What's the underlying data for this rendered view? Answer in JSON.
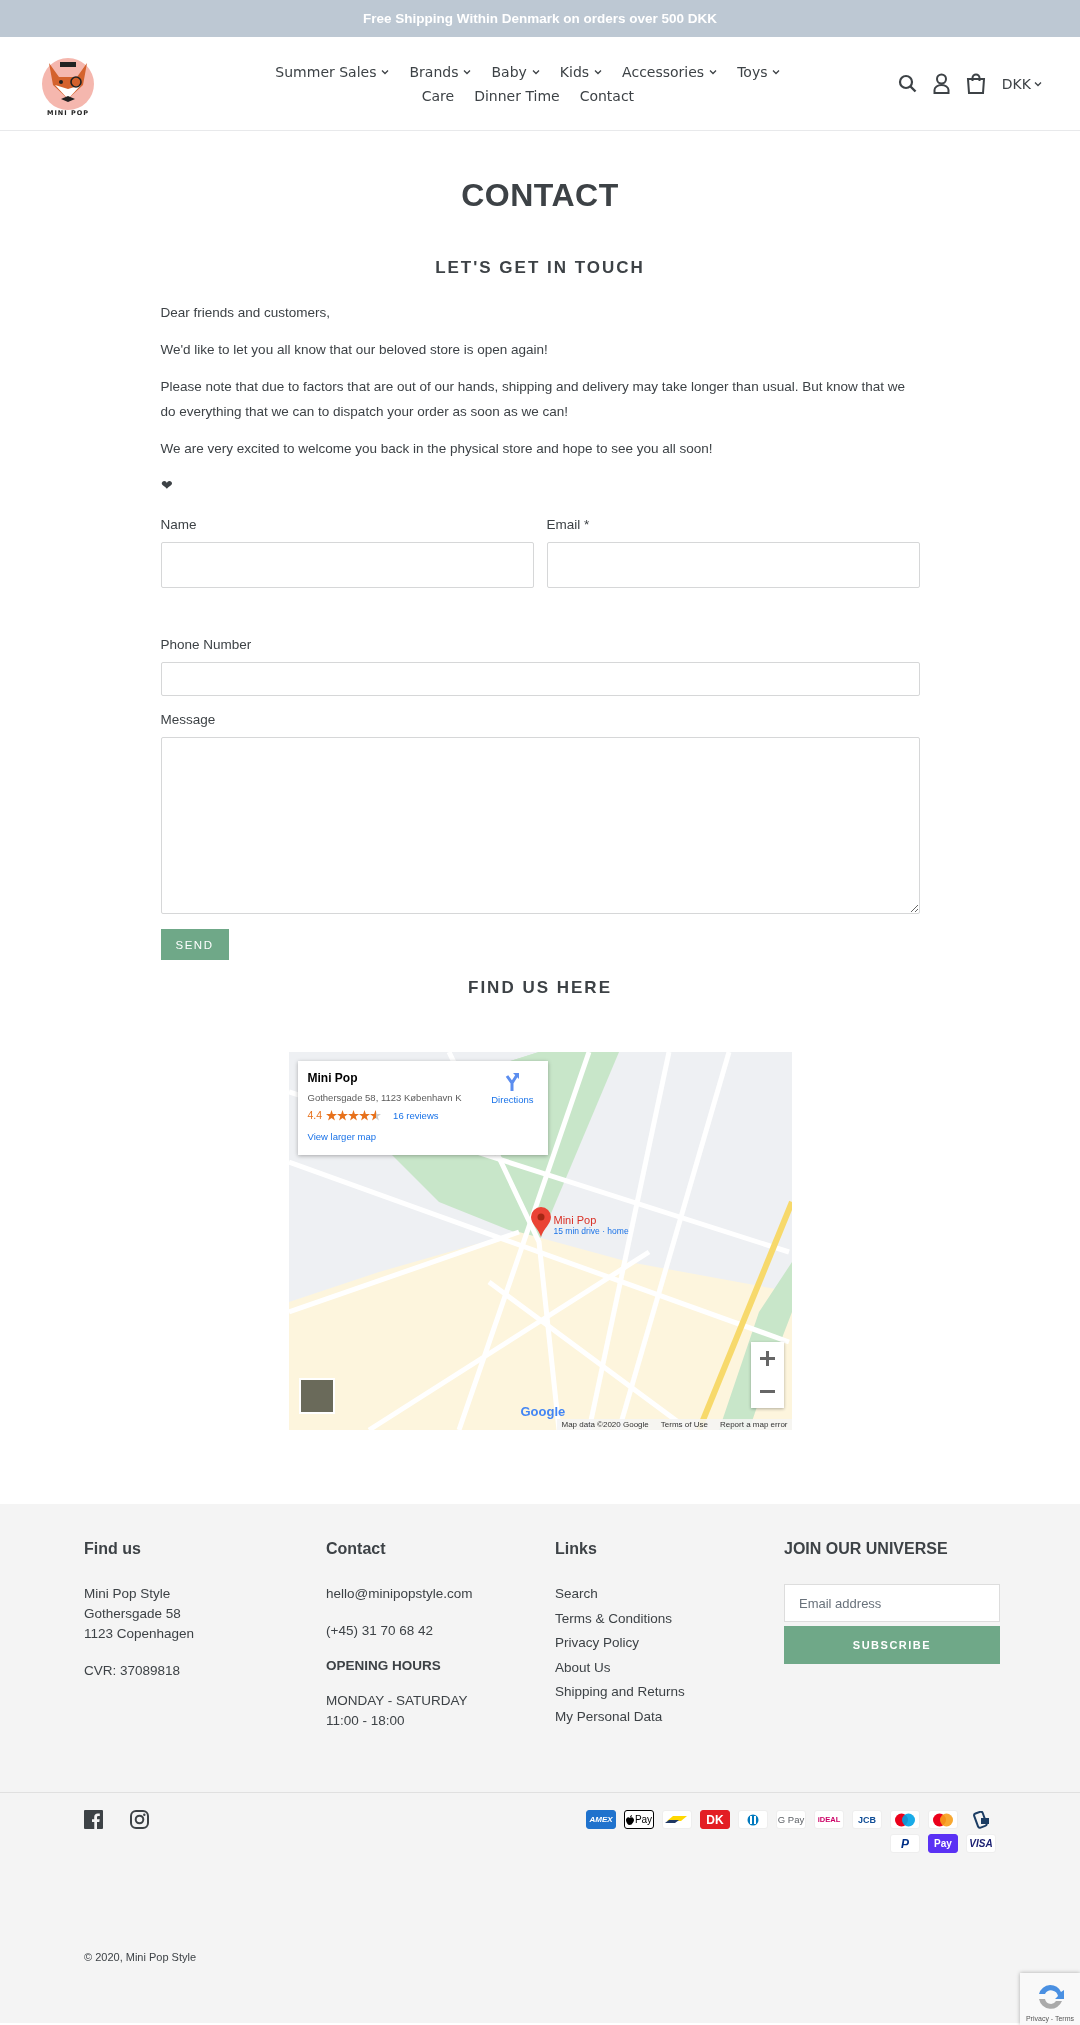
{
  "announcement": "Free Shipping Within Denmark on orders over 500 DKK",
  "header": {
    "logo_text": "MINI POP",
    "nav_rows": [
      [
        {
          "label": "Summer Sales",
          "has_caret": true
        },
        {
          "label": "Brands",
          "has_caret": true
        },
        {
          "label": "Baby",
          "has_caret": true
        },
        {
          "label": "Kids",
          "has_caret": true
        },
        {
          "label": "Accessories",
          "has_caret": true
        },
        {
          "label": "Toys",
          "has_caret": true
        }
      ],
      [
        {
          "label": "Care",
          "has_caret": false
        },
        {
          "label": "Dinner Time",
          "has_caret": false
        },
        {
          "label": "Contact",
          "has_caret": false
        }
      ]
    ],
    "currency": "DKK"
  },
  "page": {
    "title": "CONTACT",
    "subtitle": "LET'S GET IN TOUCH",
    "paragraphs": [
      "Dear friends and customers,",
      "We'd like to let you all know that our beloved store is open again!",
      "Please note that due to factors that are out of our hands, shipping and delivery may take longer than usual. But know that we do everything that we can to dispatch your order as soon as we can!",
      "We are very excited to welcome you back in the physical store and hope to see you all soon!",
      "❤"
    ],
    "form": {
      "fields": [
        {
          "kind": "half",
          "label": "Name"
        },
        {
          "kind": "half",
          "label": "Email *"
        },
        {
          "kind": "full",
          "label": "Phone Number"
        },
        {
          "kind": "textarea",
          "label": "Message"
        }
      ],
      "submit": "SEND"
    },
    "map_heading": "FIND US HERE"
  },
  "map": {
    "info": {
      "name": "Mini Pop",
      "address": "Gothersgade 58, 1123 København K",
      "rating": "4.4",
      "stars": 4.5,
      "reviews": "16 reviews",
      "directions": "Directions",
      "larger_map": "View larger map"
    },
    "pin": {
      "name": "Mini Pop",
      "detail": "15 min drive · home"
    },
    "logo": "Google",
    "attribution": "Map data ©2020 Google",
    "terms": "Terms of Use",
    "report": "Report a map error"
  },
  "footer": {
    "columns": [
      {
        "kind": "text",
        "heading": "Find us",
        "blocks": [
          [
            "Mini Pop Style",
            "Gothersgade 58",
            "1123 Copenhagen"
          ],
          [
            "CVR: 37089818"
          ]
        ]
      },
      {
        "kind": "contact",
        "heading": "Contact",
        "blocks": [
          [
            "hello@minipopstyle.com"
          ],
          [
            "(+45) 31 70 68 42"
          ]
        ],
        "hours_heading": "OPENING HOURS",
        "hours": [
          "MONDAY - SATURDAY",
          "11:00 - 18:00"
        ]
      },
      {
        "kind": "links",
        "heading": "Links",
        "links": [
          "Search",
          "Terms & Conditions",
          "Privacy Policy",
          "About Us",
          "Shipping and Returns",
          "My Personal Data"
        ]
      },
      {
        "kind": "newsletter",
        "heading": "JOIN OUR UNIVERSE",
        "placeholder": "Email address",
        "button": "SUBSCRIBE"
      }
    ],
    "payments": [
      [
        {
          "kind": "amex",
          "label": "AMEX"
        },
        {
          "kind": "applepay",
          "label": "Pay"
        },
        {
          "kind": "bancontact"
        },
        {
          "kind": "dankort",
          "label": "DK"
        },
        {
          "kind": "diners"
        },
        {
          "kind": "googlepay",
          "label": "G Pay"
        },
        {
          "kind": "ideal",
          "label": "iDEAL"
        },
        {
          "kind": "jcb",
          "label": "JCB"
        },
        {
          "kind": "maestro"
        },
        {
          "kind": "mastercard"
        },
        {
          "kind": "mobilepay"
        }
      ],
      [
        {
          "kind": "paypal",
          "label": "P"
        },
        {
          "kind": "shoppay",
          "label": "Pay"
        },
        {
          "kind": "visa",
          "label": "VISA"
        }
      ]
    ],
    "copyright": "© 2020, Mini Pop Style"
  },
  "recaptcha": "Privacy - Terms"
}
